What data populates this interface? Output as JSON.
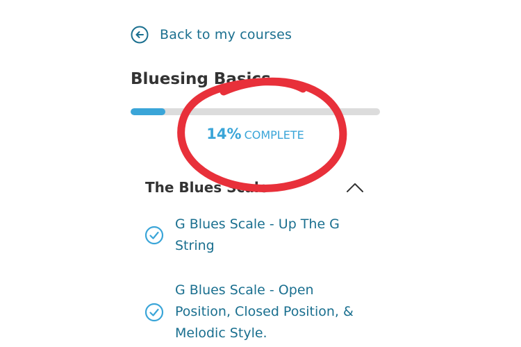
{
  "nav": {
    "back_label": "Back to my courses"
  },
  "course": {
    "title": "Bluesing Basics",
    "progress_percent": 14,
    "progress_pct_label": "14%",
    "progress_word": "COMPLETE"
  },
  "section": {
    "title": "The Blues Scale",
    "expanded": true,
    "lessons": [
      {
        "title": "G Blues Scale - Up The G String",
        "completed": true
      },
      {
        "title": "G Blues Scale - Open Position, Closed Position, & Melodic Style.",
        "completed": true
      }
    ]
  },
  "colors": {
    "link": "#1a6f8f",
    "accent": "#3aa5d8",
    "track": "#dcdcdc",
    "heading": "#333333",
    "annotation": "#e8303a"
  },
  "icons": {
    "back": "arrow-left-circle-icon",
    "collapse": "chevron-up-icon",
    "lesson_status": "check-circle-icon"
  }
}
